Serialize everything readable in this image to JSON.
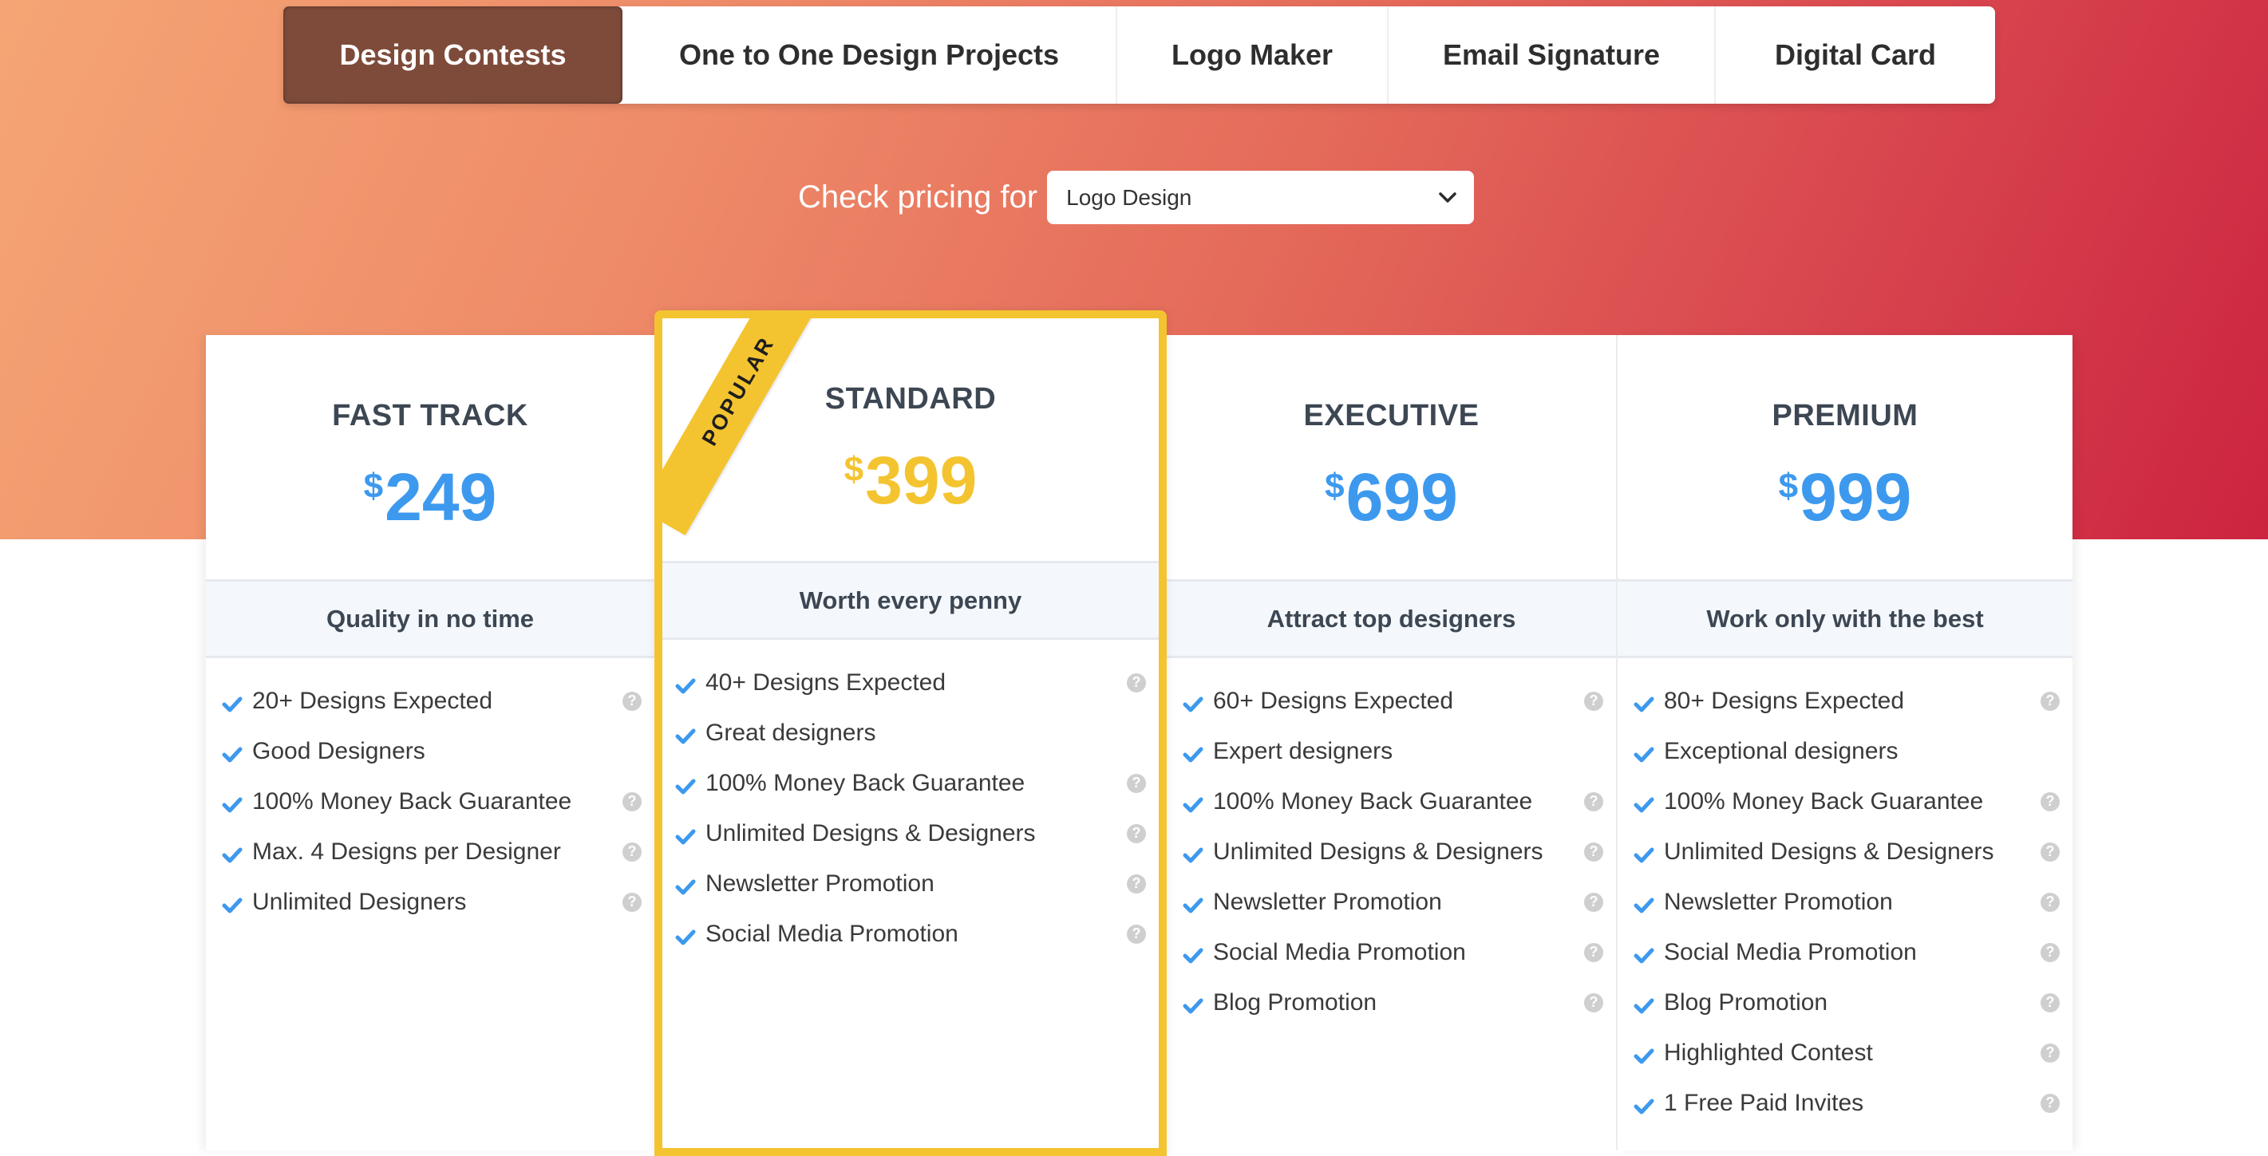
{
  "tabs": [
    {
      "label": "Design Contests",
      "active": true
    },
    {
      "label": "One to One Design Projects",
      "active": false
    },
    {
      "label": "Logo Maker",
      "active": false
    },
    {
      "label": "Email Signature",
      "active": false
    },
    {
      "label": "Digital Card",
      "active": false
    }
  ],
  "pricing_selector": {
    "label": "Check pricing for",
    "selected": "Logo Design"
  },
  "colors": {
    "accent_blue": "#3d99ee",
    "popular_yellow": "#f4c430",
    "active_tab": "#7e4b3a",
    "hero_start": "#f5a575",
    "hero_end": "#cc2440"
  },
  "plans": [
    {
      "name": "FAST TRACK",
      "currency": "$",
      "price": "249",
      "tagline": "Quality in no time",
      "popular": false,
      "features": [
        {
          "text": "20+ Designs Expected",
          "help": true
        },
        {
          "text": "Good Designers",
          "help": false
        },
        {
          "text": "100% Money Back Guarantee",
          "help": true
        },
        {
          "text": "Max. 4 Designs per Designer",
          "help": true
        },
        {
          "text": "Unlimited Designers",
          "help": true
        }
      ]
    },
    {
      "name": "STANDARD",
      "currency": "$",
      "price": "399",
      "tagline": "Worth every penny",
      "popular": true,
      "ribbon": "POPULAR",
      "features": [
        {
          "text": "40+ Designs Expected",
          "help": true
        },
        {
          "text": "Great designers",
          "help": false
        },
        {
          "text": "100% Money Back Guarantee",
          "help": true
        },
        {
          "text": "Unlimited Designs & Designers",
          "help": true
        },
        {
          "text": "Newsletter Promotion",
          "help": true
        },
        {
          "text": "Social Media Promotion",
          "help": true
        }
      ]
    },
    {
      "name": "EXECUTIVE",
      "currency": "$",
      "price": "699",
      "tagline": "Attract top designers",
      "popular": false,
      "features": [
        {
          "text": "60+ Designs Expected",
          "help": true
        },
        {
          "text": "Expert designers",
          "help": false
        },
        {
          "text": "100% Money Back Guarantee",
          "help": true
        },
        {
          "text": "Unlimited Designs & Designers",
          "help": true
        },
        {
          "text": "Newsletter Promotion",
          "help": true
        },
        {
          "text": "Social Media Promotion",
          "help": true
        },
        {
          "text": "Blog Promotion",
          "help": true
        }
      ]
    },
    {
      "name": "PREMIUM",
      "currency": "$",
      "price": "999",
      "tagline": "Work only with the best",
      "popular": false,
      "features": [
        {
          "text": "80+ Designs Expected",
          "help": true
        },
        {
          "text": "Exceptional designers",
          "help": false
        },
        {
          "text": "100% Money Back Guarantee",
          "help": true
        },
        {
          "text": "Unlimited Designs & Designers",
          "help": true
        },
        {
          "text": "Newsletter Promotion",
          "help": true
        },
        {
          "text": "Social Media Promotion",
          "help": true
        },
        {
          "text": "Blog Promotion",
          "help": true
        },
        {
          "text": "Highlighted Contest",
          "help": true
        },
        {
          "text": "1 Free Paid Invites",
          "help": true
        }
      ]
    }
  ],
  "icons": {
    "feature_check": "check-icon",
    "feature_help": "question-circle-icon",
    "select_chevron": "chevron-down-icon",
    "help_glyph": "?"
  }
}
